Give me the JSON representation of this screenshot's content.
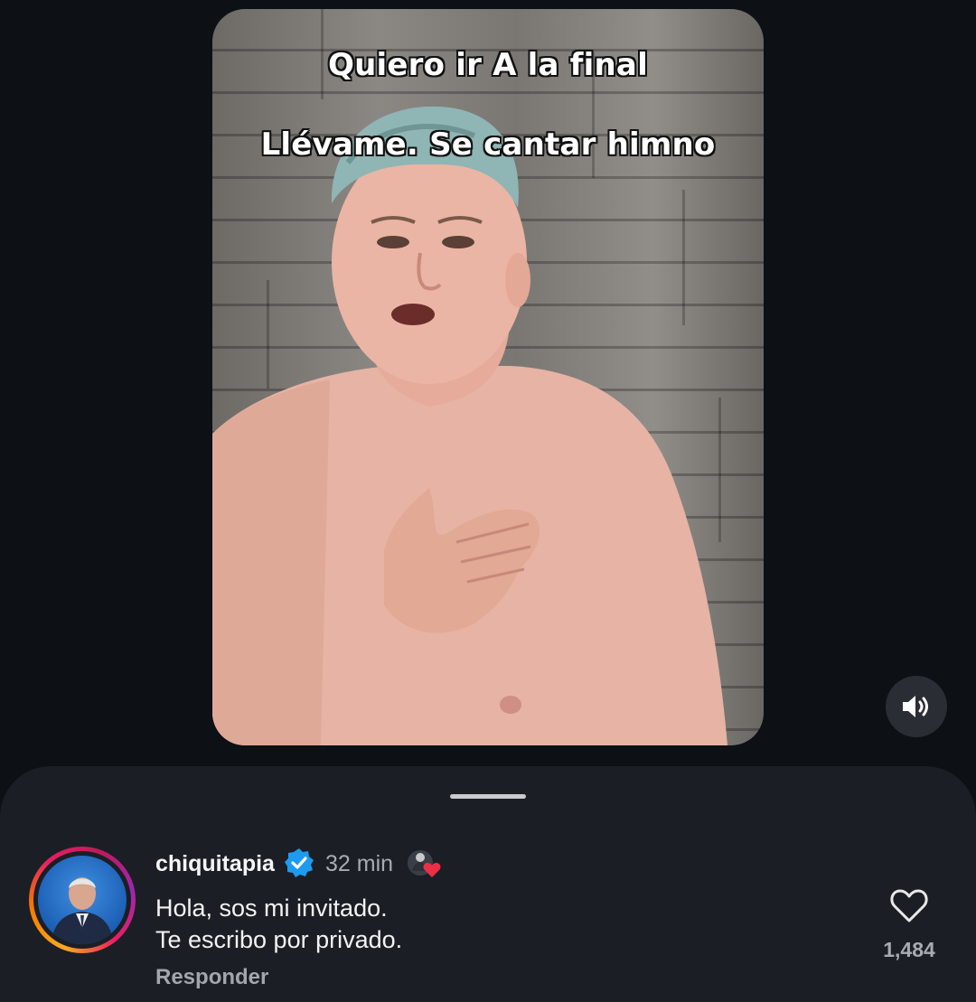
{
  "video": {
    "captions": [
      "Quiero ir A la final",
      "Llévame. Se cantar himno"
    ],
    "sound_icon": "speaker-icon"
  },
  "comment": {
    "username": "chiquitapia",
    "verified_icon": "verified-badge-icon",
    "time": "32 min",
    "liked_by_creator_icon": "creator-liked-heart-icon",
    "text_line1": "Hola, sos mi invitado.",
    "text_line2": "Te escribo por privado.",
    "reply_label": "Responder",
    "like_icon": "heart-outline-icon",
    "like_count": "1,484"
  },
  "colors": {
    "background": "#0d1015",
    "sheet": "#1b1f25",
    "verified": "#1d9bf0",
    "heart_red": "#ed2f45"
  }
}
